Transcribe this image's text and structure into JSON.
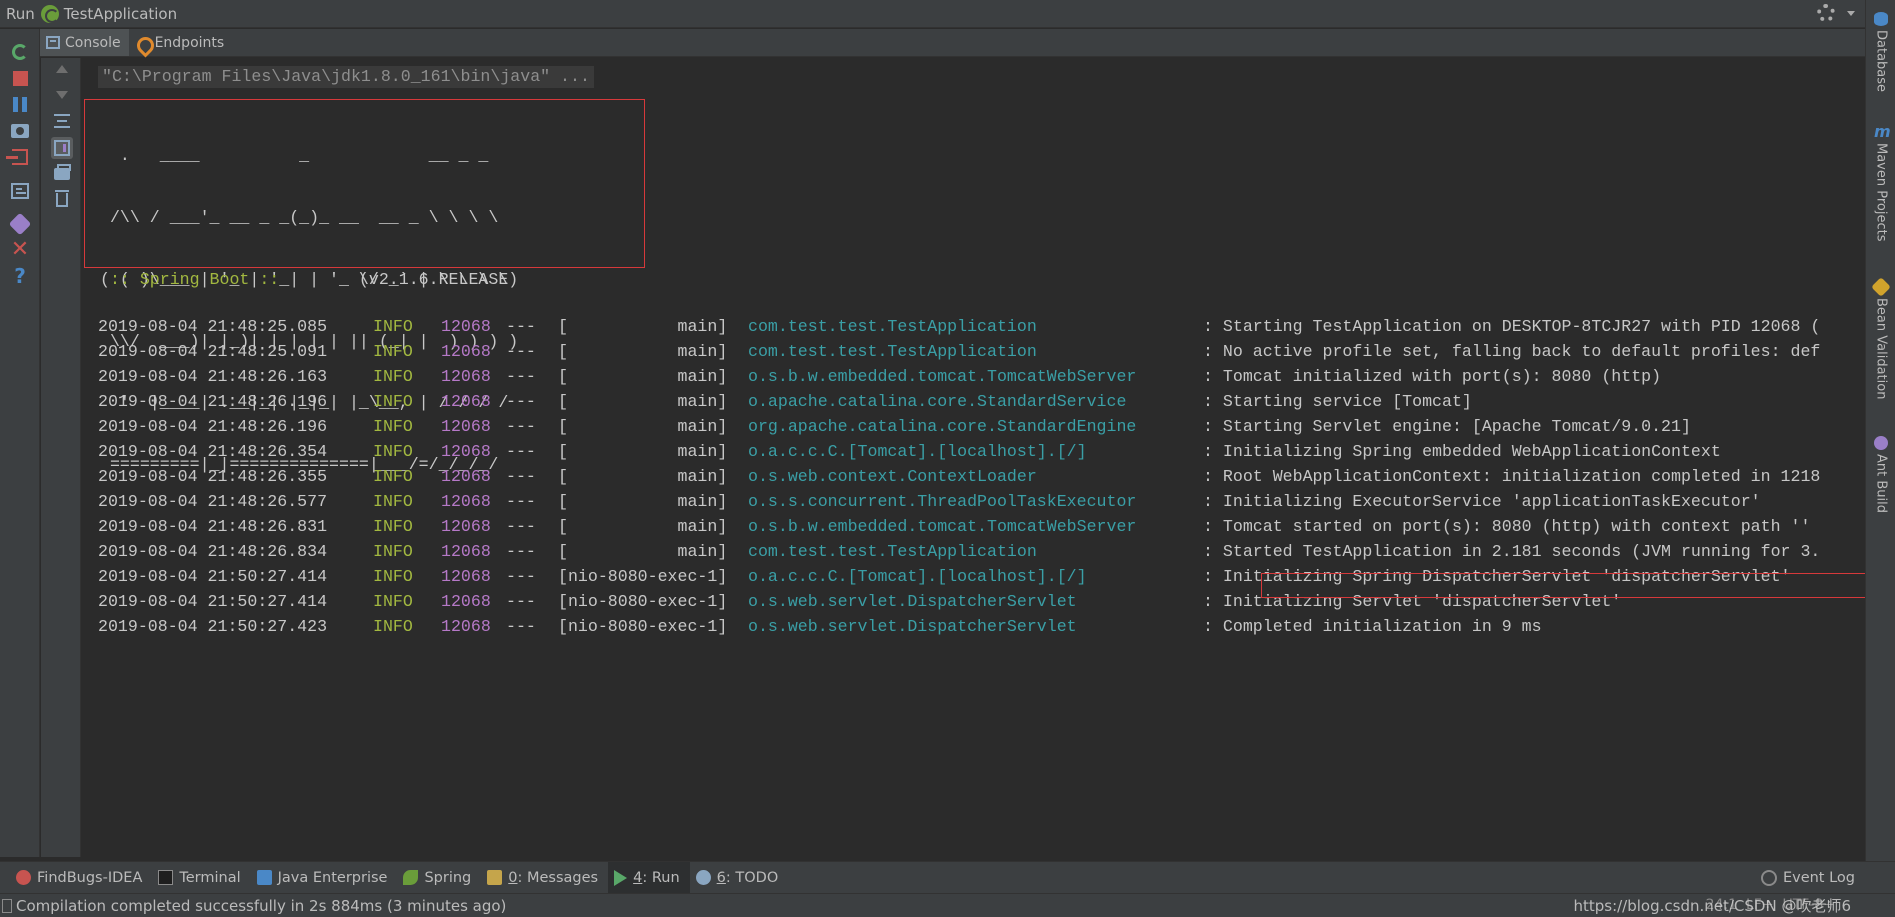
{
  "titlebar": {
    "run_label": "Run",
    "app_name": "TestApplication"
  },
  "tabs": [
    {
      "label": "Console",
      "icon": "console-icon",
      "active": true
    },
    {
      "label": "Endpoints",
      "icon": "endpoints-icon",
      "active": false
    }
  ],
  "console": {
    "command": "\"C:\\Program Files\\Java\\jdk1.8.0_161\\bin\\java\" ...",
    "banner_lines": [
      "  .   ____          _            __ _ _",
      " /\\\\ / ___'_ __ _ _(_)_ __  __ _ \\ \\ \\ \\",
      "( ( )\\___ | '_ | '_| | '_ \\/ _` | \\ \\ \\ \\",
      " \\\\/  ___)| |_)| | | | | || (_| |  ) ) ) )",
      "  '  |____| .__|_| |_|_| |_\\__, | / / / /",
      " =========|_|==============|___/=/_/_/_/"
    ],
    "boot_label": " :: Spring Boot :: ",
    "boot_version": "       (v2.1.6.RELEASE)",
    "log_rows": [
      {
        "ts": "2019-08-04 21:48:25.085",
        "level": "INFO",
        "pid": "12068",
        "sep": "---",
        "thread": "[           main]",
        "logger": "com.test.test.TestApplication",
        "msg": ": Starting TestApplication on DESKTOP-8TCJR27 with PID 12068 ("
      },
      {
        "ts": "2019-08-04 21:48:25.091",
        "level": "INFO",
        "pid": "12068",
        "sep": "---",
        "thread": "[           main]",
        "logger": "com.test.test.TestApplication",
        "msg": ": No active profile set, falling back to default profiles: def"
      },
      {
        "ts": "2019-08-04 21:48:26.163",
        "level": "INFO",
        "pid": "12068",
        "sep": "---",
        "thread": "[           main]",
        "logger": "o.s.b.w.embedded.tomcat.TomcatWebServer",
        "msg": ": Tomcat initialized with port(s): 8080 (http)"
      },
      {
        "ts": "2019-08-04 21:48:26.196",
        "level": "INFO",
        "pid": "12068",
        "sep": "---",
        "thread": "[           main]",
        "logger": "o.apache.catalina.core.StandardService",
        "msg": ": Starting service [Tomcat]"
      },
      {
        "ts": "2019-08-04 21:48:26.196",
        "level": "INFO",
        "pid": "12068",
        "sep": "---",
        "thread": "[           main]",
        "logger": "org.apache.catalina.core.StandardEngine",
        "msg": ": Starting Servlet engine: [Apache Tomcat/9.0.21]"
      },
      {
        "ts": "2019-08-04 21:48:26.354",
        "level": "INFO",
        "pid": "12068",
        "sep": "---",
        "thread": "[           main]",
        "logger": "o.a.c.c.C.[Tomcat].[localhost].[/]",
        "msg": ": Initializing Spring embedded WebApplicationContext"
      },
      {
        "ts": "2019-08-04 21:48:26.355",
        "level": "INFO",
        "pid": "12068",
        "sep": "---",
        "thread": "[           main]",
        "logger": "o.s.web.context.ContextLoader",
        "msg": ": Root WebApplicationContext: initialization completed in 1218"
      },
      {
        "ts": "2019-08-04 21:48:26.577",
        "level": "INFO",
        "pid": "12068",
        "sep": "---",
        "thread": "[           main]",
        "logger": "o.s.s.concurrent.ThreadPoolTaskExecutor",
        "msg": ": Initializing ExecutorService 'applicationTaskExecutor'"
      },
      {
        "ts": "2019-08-04 21:48:26.831",
        "level": "INFO",
        "pid": "12068",
        "sep": "---",
        "thread": "[           main]",
        "logger": "o.s.b.w.embedded.tomcat.TomcatWebServer",
        "msg": ": Tomcat started on port(s): 8080 (http) with context path ''"
      },
      {
        "ts": "2019-08-04 21:48:26.834",
        "level": "INFO",
        "pid": "12068",
        "sep": "---",
        "thread": "[           main]",
        "logger": "com.test.test.TestApplication",
        "msg": ": Started TestApplication in 2.181 seconds (JVM running for 3."
      },
      {
        "ts": "2019-08-04 21:50:27.414",
        "level": "INFO",
        "pid": "12068",
        "sep": "---",
        "thread": "[nio-8080-exec-1]",
        "logger": "o.a.c.c.C.[Tomcat].[localhost].[/]",
        "msg": ": Initializing Spring DispatcherServlet 'dispatcherServlet'"
      },
      {
        "ts": "2019-08-04 21:50:27.414",
        "level": "INFO",
        "pid": "12068",
        "sep": "---",
        "thread": "[nio-8080-exec-1]",
        "logger": "o.s.web.servlet.DispatcherServlet",
        "msg": ": Initializing Servlet 'dispatcherServlet'"
      },
      {
        "ts": "2019-08-04 21:50:27.423",
        "level": "INFO",
        "pid": "12068",
        "sep": "---",
        "thread": "[nio-8080-exec-1]",
        "logger": "o.s.web.servlet.DispatcherServlet",
        "msg": ": Completed initialization in 9 ms"
      }
    ]
  },
  "right_panel": [
    {
      "label": "Database",
      "icon": "database-icon"
    },
    {
      "label": "Maven Projects",
      "icon": "maven-icon"
    },
    {
      "label": "Bean Validation",
      "icon": "bean-validation-icon"
    },
    {
      "label": "Ant Build",
      "icon": "ant-build-icon"
    }
  ],
  "bottom_tools": {
    "findbugs": "FindBugs-IDEA",
    "terminal": "Terminal",
    "java_enterprise": "Java Enterprise",
    "spring": "Spring",
    "messages_num": "0",
    "messages": ": Messages",
    "run_num": "4",
    "run": ": Run",
    "todo_num": "6",
    "todo": ": TODO",
    "event_log": "Event Log"
  },
  "statusbar": {
    "text": "Compilation completed successfully in 2s 884ms (3 minutes ago)",
    "position": "24:1  LF÷  UTF-8÷",
    "watermark": "https://blog.csdn.net/CSDN @吹老师6"
  },
  "colors": {
    "background": "#2b2b2b",
    "panel": "#3c3f41",
    "info": "#a2b840",
    "pid": "#b679c8",
    "logger": "#3a9fa6",
    "highlight_border": "#d6393b"
  }
}
